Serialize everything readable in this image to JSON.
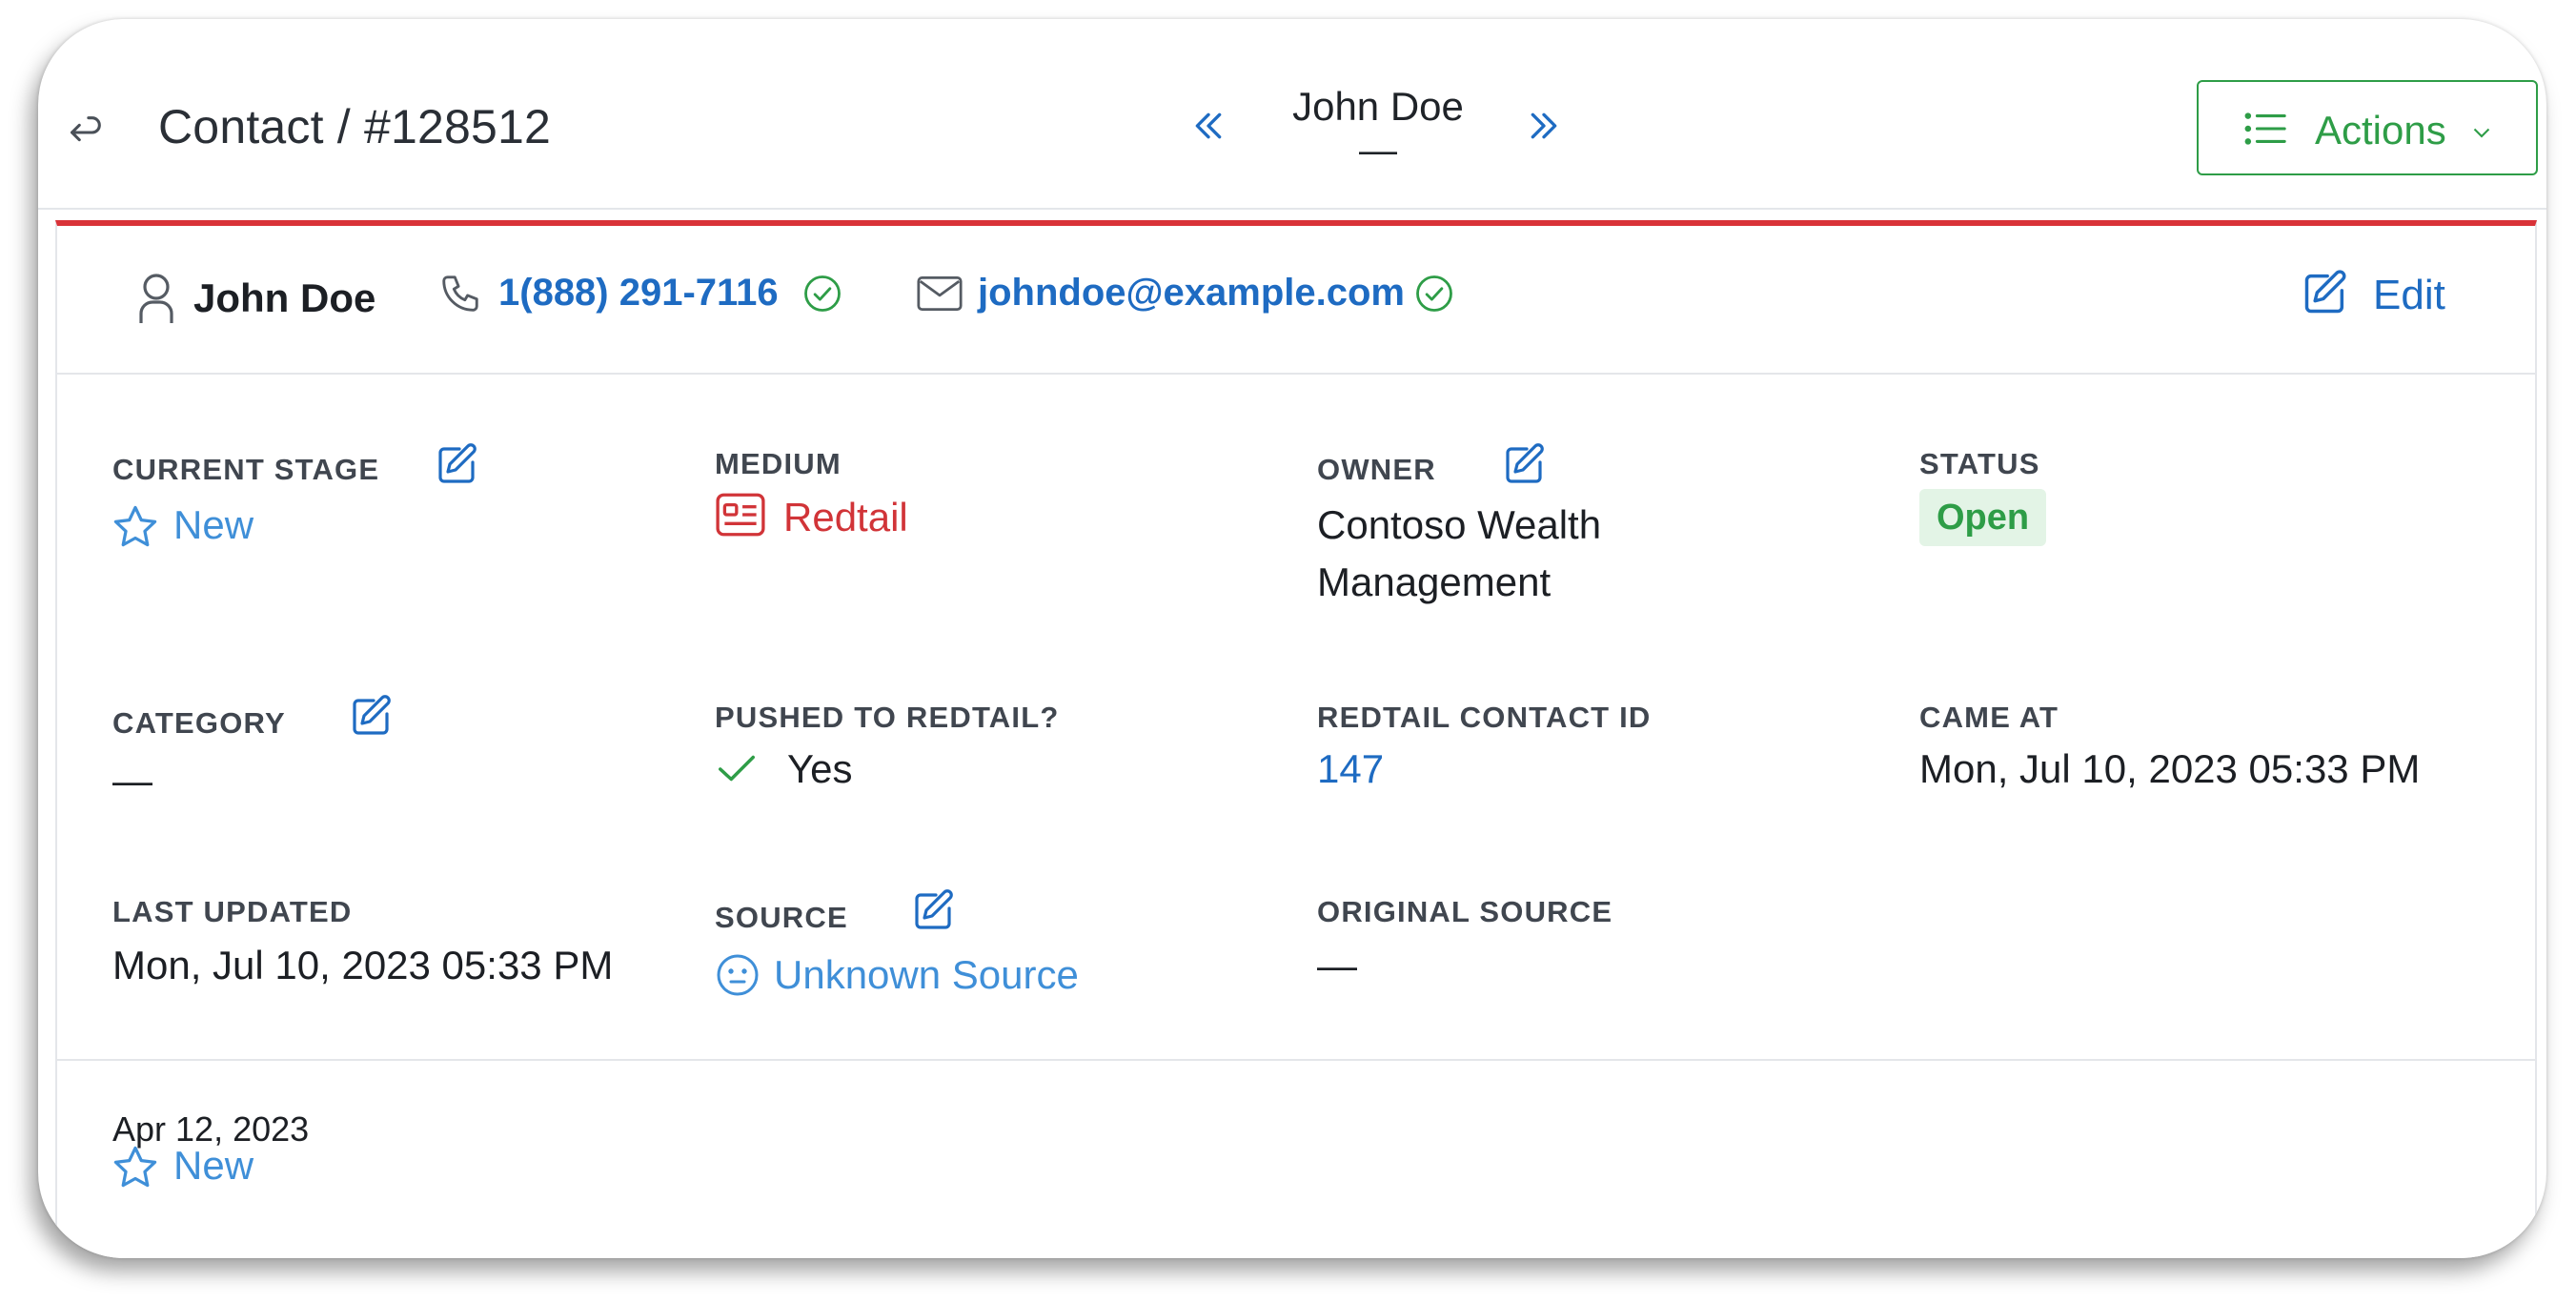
{
  "header": {
    "breadcrumb": "Contact / #128512",
    "record_name": "John Doe",
    "record_sub": "—",
    "actions_label": "Actions"
  },
  "contact": {
    "name": "John Doe",
    "phone": "1(888) 291-7116",
    "email": "johndoe@example.com",
    "edit_label": "Edit"
  },
  "fields": {
    "current_stage": {
      "label": "CURRENT STAGE",
      "value": "New"
    },
    "medium": {
      "label": "MEDIUM",
      "value": "Redtail"
    },
    "owner": {
      "label": "OWNER",
      "value_line1": "Contoso Wealth",
      "value_line2": "Management"
    },
    "status": {
      "label": "STATUS",
      "value": "Open"
    },
    "category": {
      "label": "CATEGORY",
      "value": "—"
    },
    "pushed_to_redtail": {
      "label": "PUSHED TO REDTAIL?",
      "value": "Yes"
    },
    "redtail_contact_id": {
      "label": "REDTAIL CONTACT ID",
      "value": "147"
    },
    "came_at": {
      "label": "CAME AT",
      "value": "Mon, Jul 10, 2023 05:33 PM"
    },
    "last_updated": {
      "label": "LAST UPDATED",
      "value": "Mon, Jul 10, 2023 05:33 PM"
    },
    "source": {
      "label": "SOURCE",
      "value": "Unknown Source"
    },
    "original_source": {
      "label": "ORIGINAL SOURCE",
      "value": "—"
    }
  },
  "history": {
    "date": "Apr 12, 2023",
    "stage": "New"
  },
  "colors": {
    "accent_blue": "#1e6bc2",
    "success_green": "#2e9d47",
    "alert_red": "#d93238"
  }
}
